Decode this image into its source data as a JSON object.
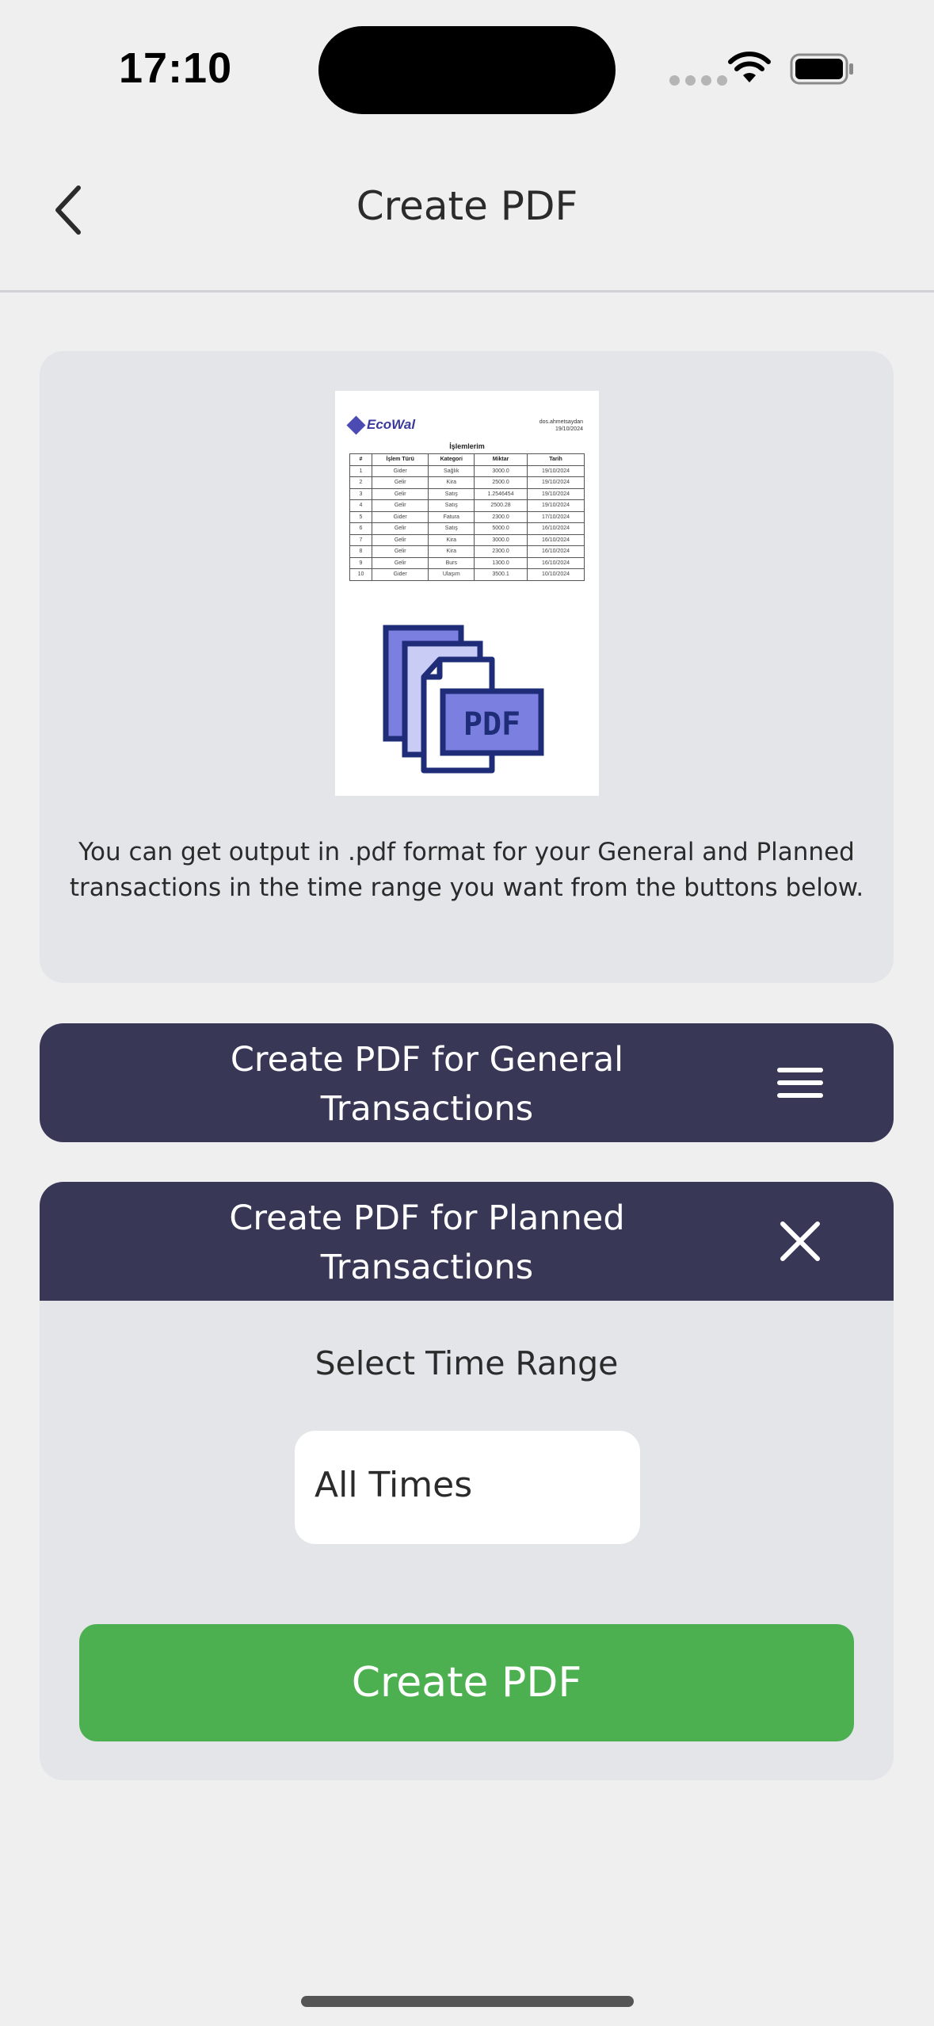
{
  "status_bar": {
    "time": "17:10"
  },
  "nav": {
    "title": "Create PDF",
    "back_icon": "chevron-left-icon"
  },
  "preview": {
    "logo_text": "EcoWal",
    "user_line_1": "dos.ahmetsaydan",
    "user_line_2": "19/10/2024",
    "heading": "İşlemlerim",
    "table": {
      "headers": [
        "#",
        "İşlem Türü",
        "Kategori",
        "Miktar",
        "Tarih"
      ],
      "rows": [
        [
          "1",
          "Gider",
          "Sağlık",
          "3000.0",
          "19/10/2024"
        ],
        [
          "2",
          "Gelir",
          "Kira",
          "2500.0",
          "19/10/2024"
        ],
        [
          "3",
          "Gelir",
          "Satış",
          "1.2546454",
          "19/10/2024"
        ],
        [
          "4",
          "Gelir",
          "Satış",
          "2500.28",
          "19/10/2024"
        ],
        [
          "5",
          "Gider",
          "Fatura",
          "2300.0",
          "17/10/2024"
        ],
        [
          "6",
          "Gelir",
          "Satış",
          "5000.0",
          "16/10/2024"
        ],
        [
          "7",
          "Gelir",
          "Kira",
          "3000.0",
          "16/10/2024"
        ],
        [
          "8",
          "Gelir",
          "Kira",
          "2300.0",
          "16/10/2024"
        ],
        [
          "9",
          "Gelir",
          "Burs",
          "1300.0",
          "16/10/2024"
        ],
        [
          "10",
          "Gider",
          "Ulaşım",
          "3500.1",
          "10/10/2024"
        ]
      ]
    },
    "illustration_label": "PDF",
    "description": "You can get output in .pdf format for your General and Planned transactions in the time range you want from the buttons below."
  },
  "general_section": {
    "title": "Create PDF for General Transactions",
    "icon": "hamburger-menu-icon"
  },
  "planned_section": {
    "title": "Create PDF for Planned Transactions",
    "icon": "close-icon",
    "range_label": "Select Time Range",
    "range_value": "All Times",
    "create_button": "Create PDF"
  },
  "colors": {
    "header_bg": "#383756",
    "panel_bg": "#e3e5e9",
    "create_button": "#4caf50",
    "page_bg": "#efefef"
  }
}
